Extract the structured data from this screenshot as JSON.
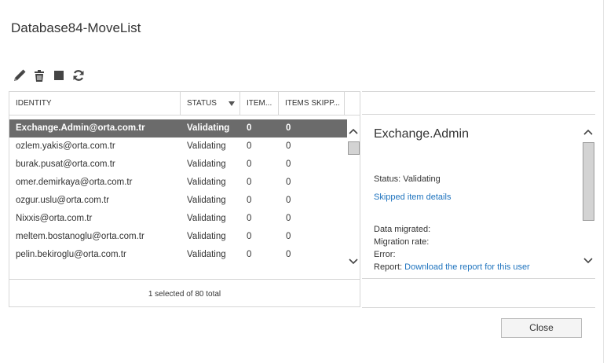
{
  "window": {
    "title": "Database84-MoveList"
  },
  "toolbar": {
    "buttons": [
      {
        "name": "edit",
        "icon": "pencil-icon"
      },
      {
        "name": "remove",
        "icon": "trash-icon"
      },
      {
        "name": "stop",
        "icon": "stop-icon"
      },
      {
        "name": "refresh",
        "icon": "refresh-icon"
      }
    ]
  },
  "list": {
    "columns": {
      "identity": "IDENTITY",
      "status": "STATUS",
      "items": "ITEM...",
      "items_skipped": "ITEMS SKIPP..."
    },
    "rows": [
      {
        "identity": "Exchange.Admin@orta.com.tr",
        "status": "Validating",
        "items": "0",
        "skipped": "0",
        "selected": true
      },
      {
        "identity": "ozlem.yakis@orta.com.tr",
        "status": "Validating",
        "items": "0",
        "skipped": "0"
      },
      {
        "identity": "burak.pusat@orta.com.tr",
        "status": "Validating",
        "items": "0",
        "skipped": "0"
      },
      {
        "identity": "omer.demirkaya@orta.com.tr",
        "status": "Validating",
        "items": "0",
        "skipped": "0"
      },
      {
        "identity": "ozgur.uslu@orta.com.tr",
        "status": "Validating",
        "items": "0",
        "skipped": "0"
      },
      {
        "identity": "Nixxis@orta.com.tr",
        "status": "Validating",
        "items": "0",
        "skipped": "0"
      },
      {
        "identity": "meltem.bostanoglu@orta.com.tr",
        "status": "Validating",
        "items": "0",
        "skipped": "0"
      },
      {
        "identity": "pelin.bekiroglu@orta.com.tr",
        "status": "Validating",
        "items": "0",
        "skipped": "0"
      }
    ],
    "footer": "1 selected of 80 total"
  },
  "details": {
    "name": "Exchange.Admin",
    "status": "Status: Validating",
    "skipped_link": "Skipped item details",
    "data_migrated": "Data migrated:",
    "migration_rate": "Migration rate:",
    "error": "Error:",
    "report_label": "Report:",
    "report_link": "Download the report for this user"
  },
  "actions": {
    "close": "Close"
  },
  "colors": {
    "selected_row": "#6b6b6b",
    "link": "#1e73be",
    "border": "#d6d6d6"
  }
}
